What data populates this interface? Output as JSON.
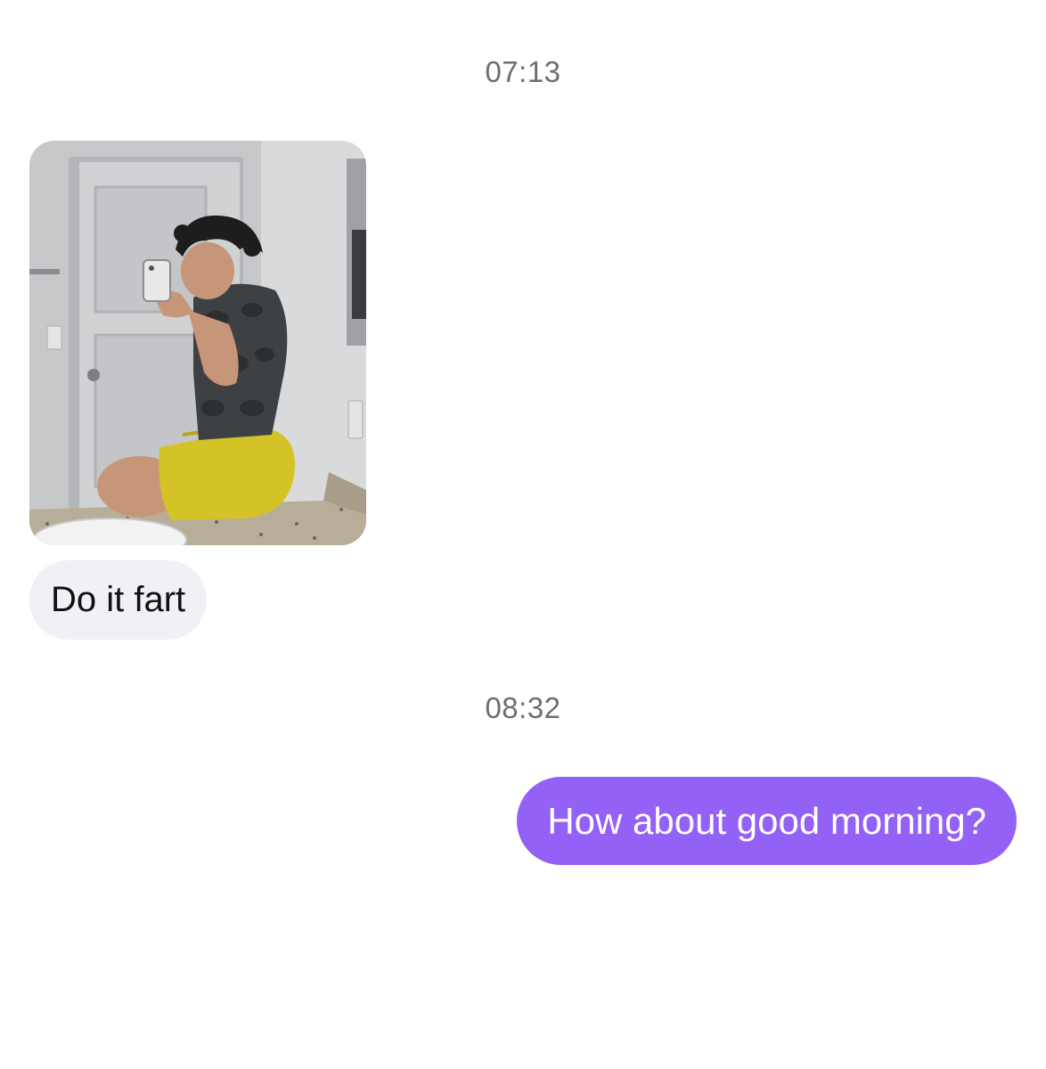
{
  "conversation": {
    "messages": [
      {
        "timestamp": "07:13",
        "direction": "incoming",
        "attachment": {
          "kind": "photo",
          "subject": "mirror-selfie"
        },
        "text": "Do it fart"
      },
      {
        "timestamp": "08:32",
        "direction": "outgoing",
        "text": "How about good morning?"
      }
    ]
  },
  "colors": {
    "incoming_bubble": "#f0f0f5",
    "outgoing_bubble": "#9361f5",
    "timestamp_text": "#6d6d72",
    "background": "#ffffff"
  }
}
